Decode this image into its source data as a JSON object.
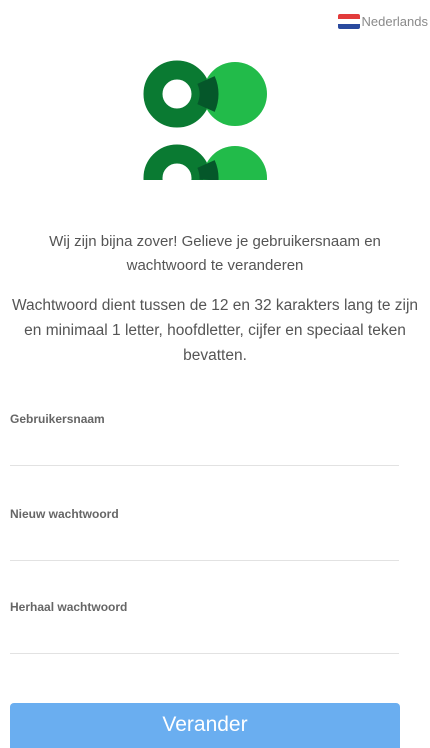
{
  "language": {
    "label": "Nederlands",
    "flag_icon": "netherlands-flag-icon"
  },
  "logo": {
    "icon": "green-rings-logo",
    "colors": {
      "dark_green": "#0a7a32",
      "light_green": "#22bb4a",
      "darkest_green": "#05572a"
    }
  },
  "intro_text": "Wij zijn bijna zover! Gelieve je gebruikersnaam en wachtwoord te veranderen",
  "rules_text": "Wachtwoord dient tussen de 12 en 32 karakters lang te zijn en minimaal 1 letter, hoofdletter, cijfer en speciaal teken bevatten.",
  "form": {
    "username": {
      "label": "Gebruikersnaam",
      "value": ""
    },
    "new_password": {
      "label": "Nieuw wachtwoord",
      "value": ""
    },
    "repeat_password": {
      "label": "Herhaal wachtwoord",
      "value": ""
    }
  },
  "submit_label": "Verander",
  "colors": {
    "button": "#6aaef0",
    "text": "#555555"
  }
}
